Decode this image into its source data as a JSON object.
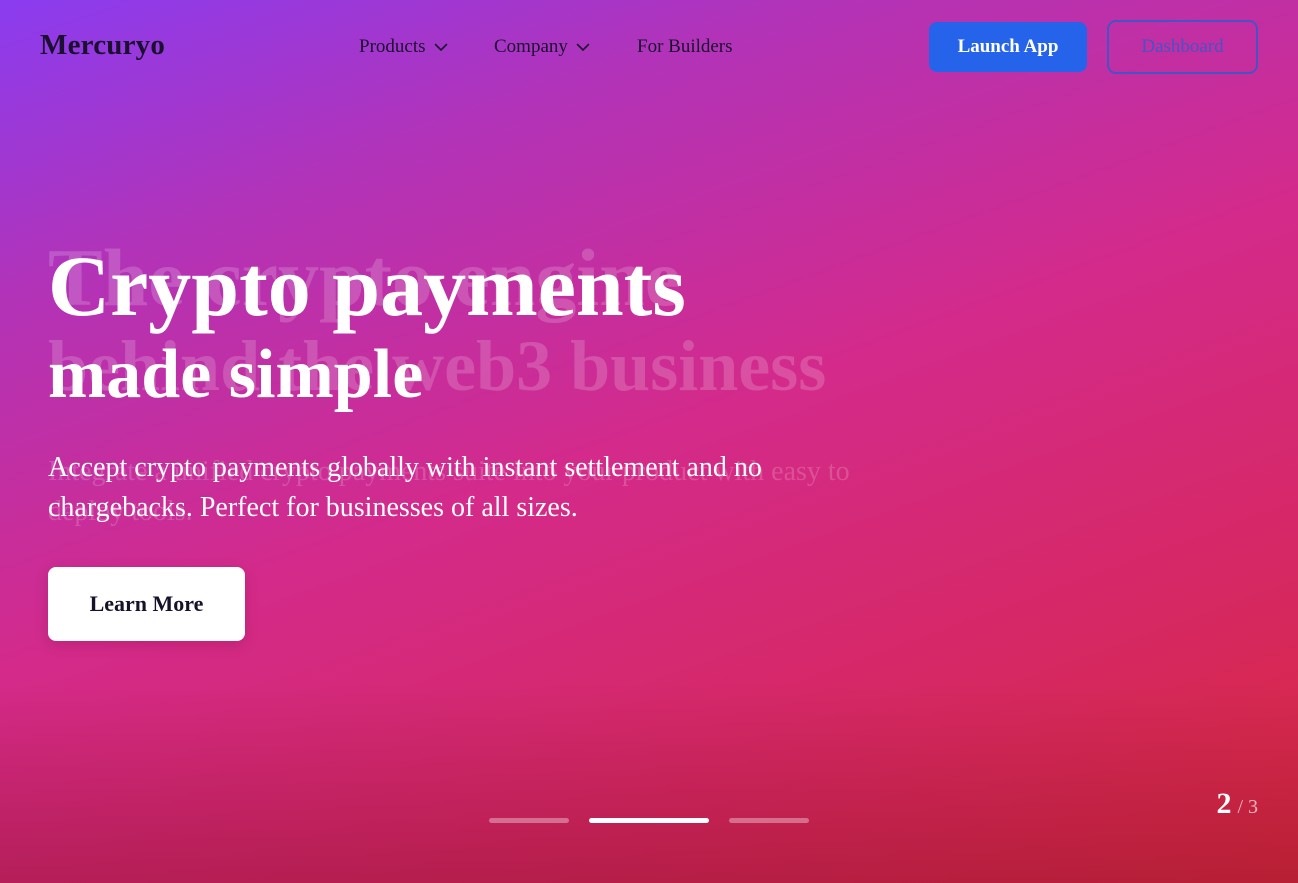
{
  "nav": {
    "logo": "Mercuryo",
    "menu": [
      {
        "label": "Products",
        "has_dropdown": true,
        "icon": "chevron-down-icon"
      },
      {
        "label": "Company",
        "has_dropdown": true,
        "icon": "chevron-down-icon"
      },
      {
        "label": "For Builders",
        "has_dropdown": false
      }
    ],
    "launch_label": "Launch App",
    "dashboard_label": "Dashboard"
  },
  "hero": {
    "title_line1": "Crypto payments",
    "title_line2": "made simple",
    "description": "Accept crypto payments globally with instant settlement and no chargebacks. Perfect for businesses of all sizes.",
    "cta_label": "Learn More",
    "previous_slide_ghost": {
      "title_line1": "The crypto engine",
      "title_line2": "behind the web3 business",
      "description": "Integrate a unified crypto payments suite into your product with easy to deploy tools."
    }
  },
  "slider": {
    "current": "2",
    "separator": "/",
    "total": "3",
    "active_index": 1,
    "slides": 3
  },
  "colors": {
    "launch_button": "#2563eb",
    "dashboard_border": "#3a57c8",
    "gradient_start": "#8a3cf0",
    "gradient_mid": "#d42a8a",
    "gradient_end": "#d92a3a"
  }
}
